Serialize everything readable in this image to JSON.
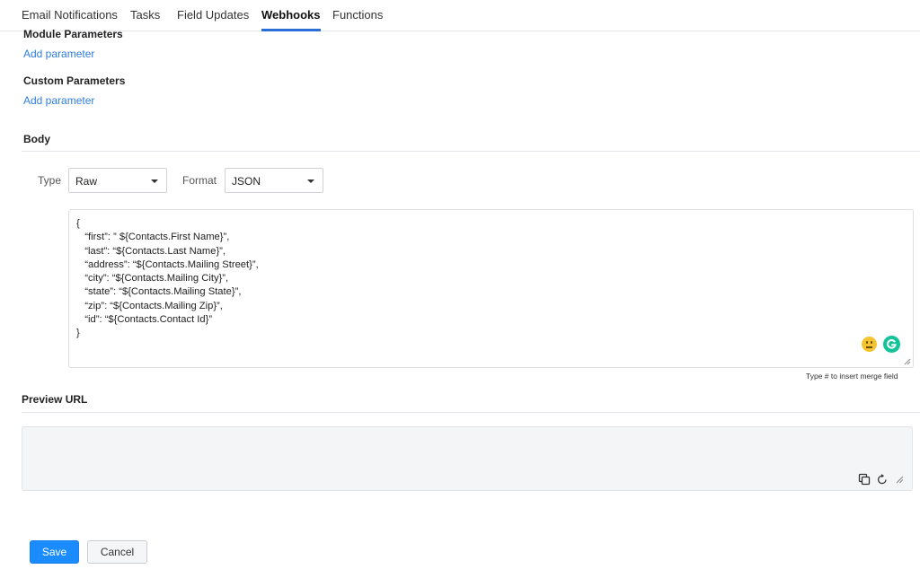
{
  "tabs": [
    {
      "label": "Email Notifications",
      "active": false
    },
    {
      "label": "Tasks",
      "active": false
    },
    {
      "label": "Field Updates",
      "active": false
    },
    {
      "label": "Webhooks",
      "active": true
    },
    {
      "label": "Functions",
      "active": false
    }
  ],
  "module_parameters": {
    "title": "Module Parameters",
    "add_link": "Add parameter"
  },
  "custom_parameters": {
    "title": "Custom Parameters",
    "add_link": "Add parameter"
  },
  "body": {
    "title": "Body",
    "type_label": "Type",
    "type_value": "Raw",
    "format_label": "Format",
    "format_value": "JSON",
    "content": "{\n   “first”: ” ${Contacts.First Name}”,\n   “last”: “${Contacts.Last Name}”,\n   “address”: “${Contacts.Mailing Street}”,\n   “city”: “${Contacts.Mailing City}”,\n   “state”: “${Contacts.Mailing State}”,\n   “zip”: “${Contacts.Mailing Zip}”,\n   “id”: “${Contacts.Contact Id}”\n}",
    "hint": "Type # to insert merge field"
  },
  "preview": {
    "title": "Preview URL",
    "value": ""
  },
  "actions": {
    "save_label": "Save",
    "cancel_label": "Cancel"
  },
  "icons": [
    "neutral-face-emoji-icon",
    "grammarly-icon",
    "resize-handle-icon",
    "copy-icon",
    "refresh-icon"
  ],
  "colors": {
    "accent": "#1a8cff",
    "link": "#2f7ee6",
    "tab_underline": "#2b6ed6",
    "grammarly": "#15c39a"
  }
}
